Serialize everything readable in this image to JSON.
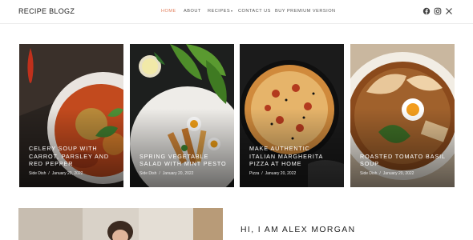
{
  "header": {
    "brand": "RECIPE BLOGZ",
    "nav": [
      "HOME",
      "ABOUT",
      "RECIPES",
      "CONTACT US",
      "BUY PREMIUM VERSION"
    ],
    "active_nav": "HOME",
    "social_icons": [
      "facebook-icon",
      "instagram-icon",
      "x-twitter-icon"
    ]
  },
  "posts": [
    {
      "title": "CELERY SOUP WITH CARROT, PARSLEY AND RED PEPPER",
      "category": "Side Dish",
      "date": "January 20, 2022"
    },
    {
      "title": "SPRING VEGETABLE SALAD WITH MINT PESTO",
      "category": "Side Dish",
      "date": "January 20, 2022"
    },
    {
      "title": "MAKE AUTHENTIC ITALIAN MARGHERITA PIZZA AT HOME",
      "category": "Pizza",
      "date": "January 20, 2022"
    },
    {
      "title": "ROASTED TOMATO BASIL SOUP",
      "category": "Side Dish",
      "date": "January 20, 2022"
    }
  ],
  "about": {
    "heading": "HI, I AM ALEX MORGAN"
  },
  "colors": {
    "accent": "#e2805f",
    "text": "#222222",
    "muted": "#555555"
  }
}
